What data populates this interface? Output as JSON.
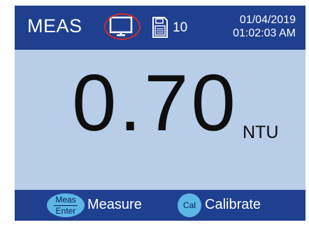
{
  "header": {
    "mode": "MEAS",
    "screen_icon": "monitor-icon",
    "storage_icon": "floppy-disk-icon",
    "stored_count": "10",
    "date": "01/04/2019",
    "time": "01:02:03 AM"
  },
  "reading": {
    "value": "0.70",
    "unit": "NTU"
  },
  "footer": {
    "meas_key_top": "Meas",
    "meas_key_bottom": "Enter",
    "measure_label": "Measure",
    "cal_key": "Cal",
    "calibrate_label": "Calibrate"
  },
  "colors": {
    "bar": "#1f3f8f",
    "display": "#b7cde8",
    "key": "#5cb6e6",
    "highlight_ring": "#d42a2a"
  }
}
